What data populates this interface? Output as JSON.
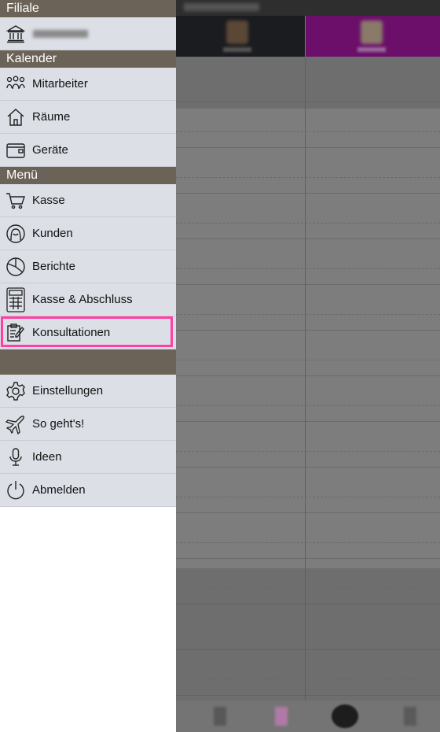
{
  "drawer": {
    "sections": {
      "filiale": {
        "title": "Filiale",
        "branch_icon": "bank-building-icon"
      },
      "kalender": {
        "title": "Kalender",
        "items": [
          {
            "label": "Mitarbeiter",
            "icon": "people-group-icon"
          },
          {
            "label": "Räume",
            "icon": "house-icon"
          },
          {
            "label": "Geräte",
            "icon": "device-box-icon"
          }
        ]
      },
      "menu": {
        "title": "Menü",
        "items": [
          {
            "label": "Kasse",
            "icon": "shopping-cart-icon"
          },
          {
            "label": "Kunden",
            "icon": "customer-head-icon"
          },
          {
            "label": "Berichte",
            "icon": "pie-chart-icon"
          },
          {
            "label": "Kasse & Abschluss",
            "icon": "calculator-icon"
          },
          {
            "label": "Konsultationen",
            "icon": "clipboard-pen-icon",
            "highlighted": true
          }
        ]
      },
      "footer": {
        "items": [
          {
            "label": "Einstellungen",
            "icon": "gear-icon"
          },
          {
            "label": "So geht's!",
            "icon": "airplane-icon"
          },
          {
            "label": "Ideen",
            "icon": "microphone-icon"
          },
          {
            "label": "Abmelden",
            "icon": "power-icon"
          }
        ]
      }
    }
  },
  "colors": {
    "section_header": "#6b6358",
    "menu_item_bg": "#dcdfe6",
    "highlight_border": "#ff3fa4",
    "staff_2_column": "#6b0f6b"
  }
}
